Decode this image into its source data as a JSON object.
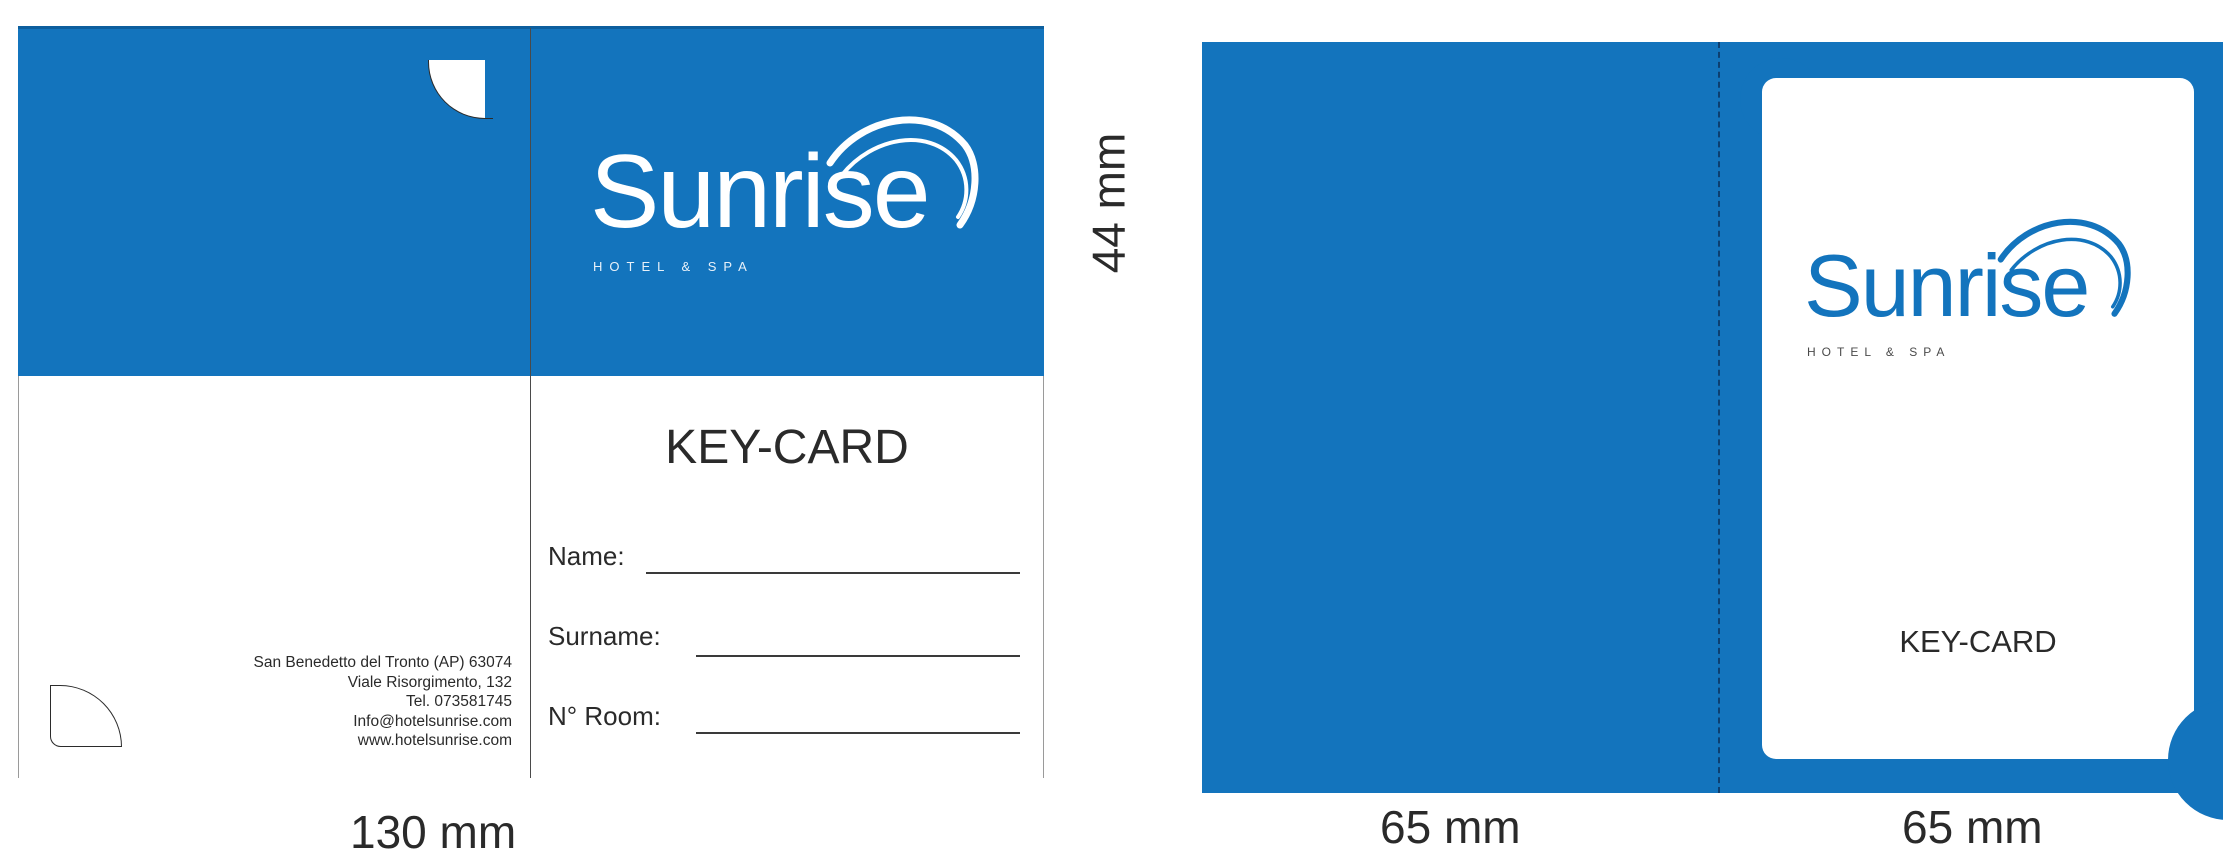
{
  "colors": {
    "brand_blue": "#1374bd",
    "paper": "#ffffff",
    "ink": "#2a2a2a"
  },
  "flat_layout": {
    "logo": {
      "wordmark": "Sunrise",
      "subtitle": "HOTEL & SPA",
      "arc_icon": "sunrise-arc-icon"
    },
    "card_title": "KEY-CARD",
    "form": {
      "name_label": "Name:",
      "surname_label": "Surname:",
      "room_label": "N° Room:"
    },
    "address": [
      "San Benedetto del Tronto (AP) 63074",
      "Viale Risorgimento, 132",
      "Tel. 073581745",
      "Info@hotelsunrise.com",
      "www.hotelsunrise.com"
    ],
    "dimension_height": "44 mm",
    "dimension_width": "130 mm"
  },
  "folded_view": {
    "logo": {
      "wordmark": "Sunrise",
      "subtitle": "HOTEL & SPA",
      "arc_icon": "sunrise-arc-icon"
    },
    "card_label": "KEY-CARD",
    "dimension_left": "65 mm",
    "dimension_right": "65 mm"
  }
}
